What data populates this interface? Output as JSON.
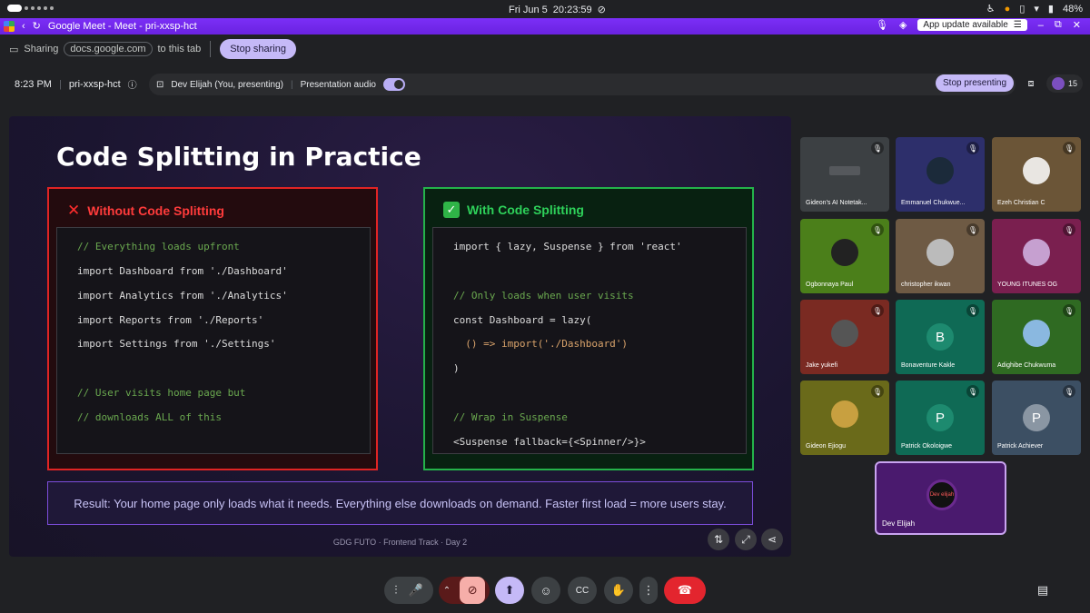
{
  "status": {
    "date": "Fri Jun 5",
    "time": "20:23:59",
    "battery": "48%"
  },
  "browser": {
    "title": "Google Meet - Meet - pri-xxsp-hct",
    "update_label": "App update available"
  },
  "share_bar": {
    "sharing_label": "Sharing",
    "domain": "docs.google.com",
    "suffix": "to this tab",
    "stop_label": "Stop sharing"
  },
  "meet": {
    "time": "8:23 PM",
    "code": "pri-xxsp-hct",
    "presenting_label": "Dev Elijah (You, presenting)",
    "audio_label": "Presentation audio",
    "stop_presenting_label": "Stop presenting",
    "participant_count": "15"
  },
  "slide": {
    "title": "Code Splitting in Practice",
    "left": {
      "heading": "Without Code Splitting",
      "lines": [
        "// Everything loads upfront",
        "import Dashboard from './Dashboard'",
        "import Analytics from './Analytics'",
        "import Reports from './Reports'",
        "import Settings from './Settings'",
        "",
        "// User visits home page but",
        "// downloads ALL of this"
      ]
    },
    "right": {
      "heading": "With Code Splitting",
      "lines": [
        "import { lazy, Suspense } from 'react'",
        "",
        "// Only loads when user visits",
        "const Dashboard = lazy(",
        "  () => import('./Dashboard')",
        ")",
        "",
        "// Wrap in Suspense",
        "<Suspense fallback={<Spinner/>}>"
      ]
    },
    "result": "Result: Your home page only loads what it needs. Everything else downloads on demand. Faster first load = more users stay.",
    "footer": "GDG FUTO  ·  Frontend Track  ·  Day 2"
  },
  "participants": [
    {
      "name": "Gideon's AI Notetak...",
      "bg": "#3c4043",
      "kind": "notetaker"
    },
    {
      "name": "Emmanuel Chukwue...",
      "bg": "#2d2f6b",
      "kind": "photo",
      "av": "#1b2a3a"
    },
    {
      "name": "Ezeh Christian C",
      "bg": "#6b5537",
      "kind": "photo",
      "av": "#e9e6e2"
    },
    {
      "name": "Ogbonnaya Paul",
      "bg": "#4b7f1a",
      "kind": "photo",
      "av": "#222"
    },
    {
      "name": "christopher ikwan",
      "bg": "#6e5a44",
      "kind": "photo",
      "av": "#bbb"
    },
    {
      "name": "YOUNG ITUNES OG",
      "bg": "#7a1f4f",
      "kind": "photo",
      "av": "#c6a0d0"
    },
    {
      "name": "Jake yukefi",
      "bg": "#7a2a22",
      "kind": "photo",
      "av": "#555"
    },
    {
      "name": "Bonaventure Kakle",
      "bg": "#0f6a55",
      "kind": "letter",
      "letter": "B",
      "av": "#1d8a6f"
    },
    {
      "name": "Adighibe Chukwuma",
      "bg": "#2f6a22",
      "kind": "photo",
      "av": "#8ab8e0"
    },
    {
      "name": "Gideon Ejiogu",
      "bg": "#6a6a1a",
      "kind": "photo",
      "av": "#c8a040"
    },
    {
      "name": "Patrick Okoloigwe",
      "bg": "#0f6a55",
      "kind": "letter",
      "letter": "P",
      "av": "#1d8a6f"
    },
    {
      "name": "Patrick Achiever",
      "bg": "#3c4f63",
      "kind": "letter",
      "letter": "P",
      "av": "#8a96a3"
    }
  ],
  "self_tile": {
    "name": "Dev Elijah",
    "logo_text": "Dev elijah"
  },
  "icons": {
    "mic": "mic-icon",
    "camera-off": "camera-off-icon",
    "present": "present-icon",
    "emoji": "emoji-icon",
    "captions": "captions-icon",
    "hand": "raise-hand-icon",
    "more": "more-options-icon",
    "end-call": "end-call-icon",
    "chat": "chat-icon"
  },
  "colors": {
    "accent": "#c5b9f7",
    "browser_bar": "#7b2ff7",
    "end_call": "#e3252e",
    "danger": "#e02424",
    "success": "#24b34a"
  }
}
